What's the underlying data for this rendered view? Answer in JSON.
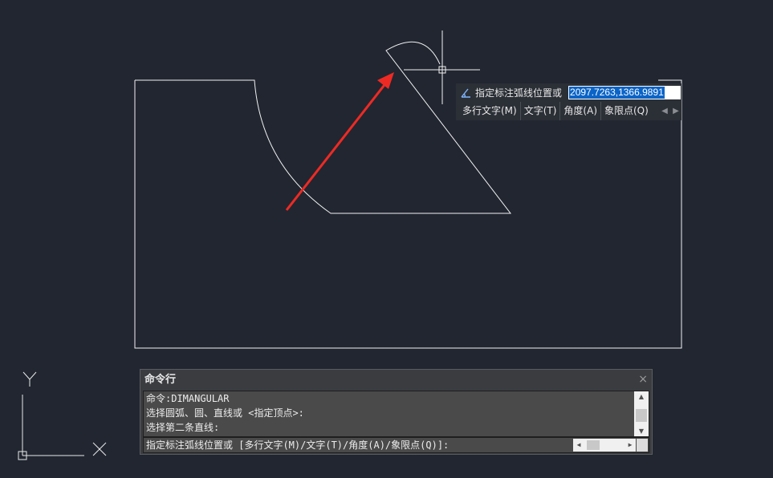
{
  "dynamic_input": {
    "prompt": "指定标注弧线位置或",
    "value": "2097.7263,1366.9891",
    "options": [
      "多行文字(M)",
      "文字(T)",
      "角度(A)",
      "象限点(Q)"
    ],
    "icon": "dimension-angle-icon"
  },
  "ucs": {
    "y_label": "Y",
    "x_label": "X"
  },
  "command_line": {
    "title": "命令行",
    "history": [
      "命令:DIMANGULAR",
      "选择圆弧、圆、直线或 <指定顶点>:",
      "选择第二条直线:"
    ],
    "current": "指定标注弧线位置或 [多行文字(M)/文字(T)/角度(A)/象限点(Q)]:"
  },
  "colors": {
    "background": "#212630",
    "geometry": "#ffffff",
    "arrow": "#ee2a24",
    "selection": "#0a64c8"
  }
}
